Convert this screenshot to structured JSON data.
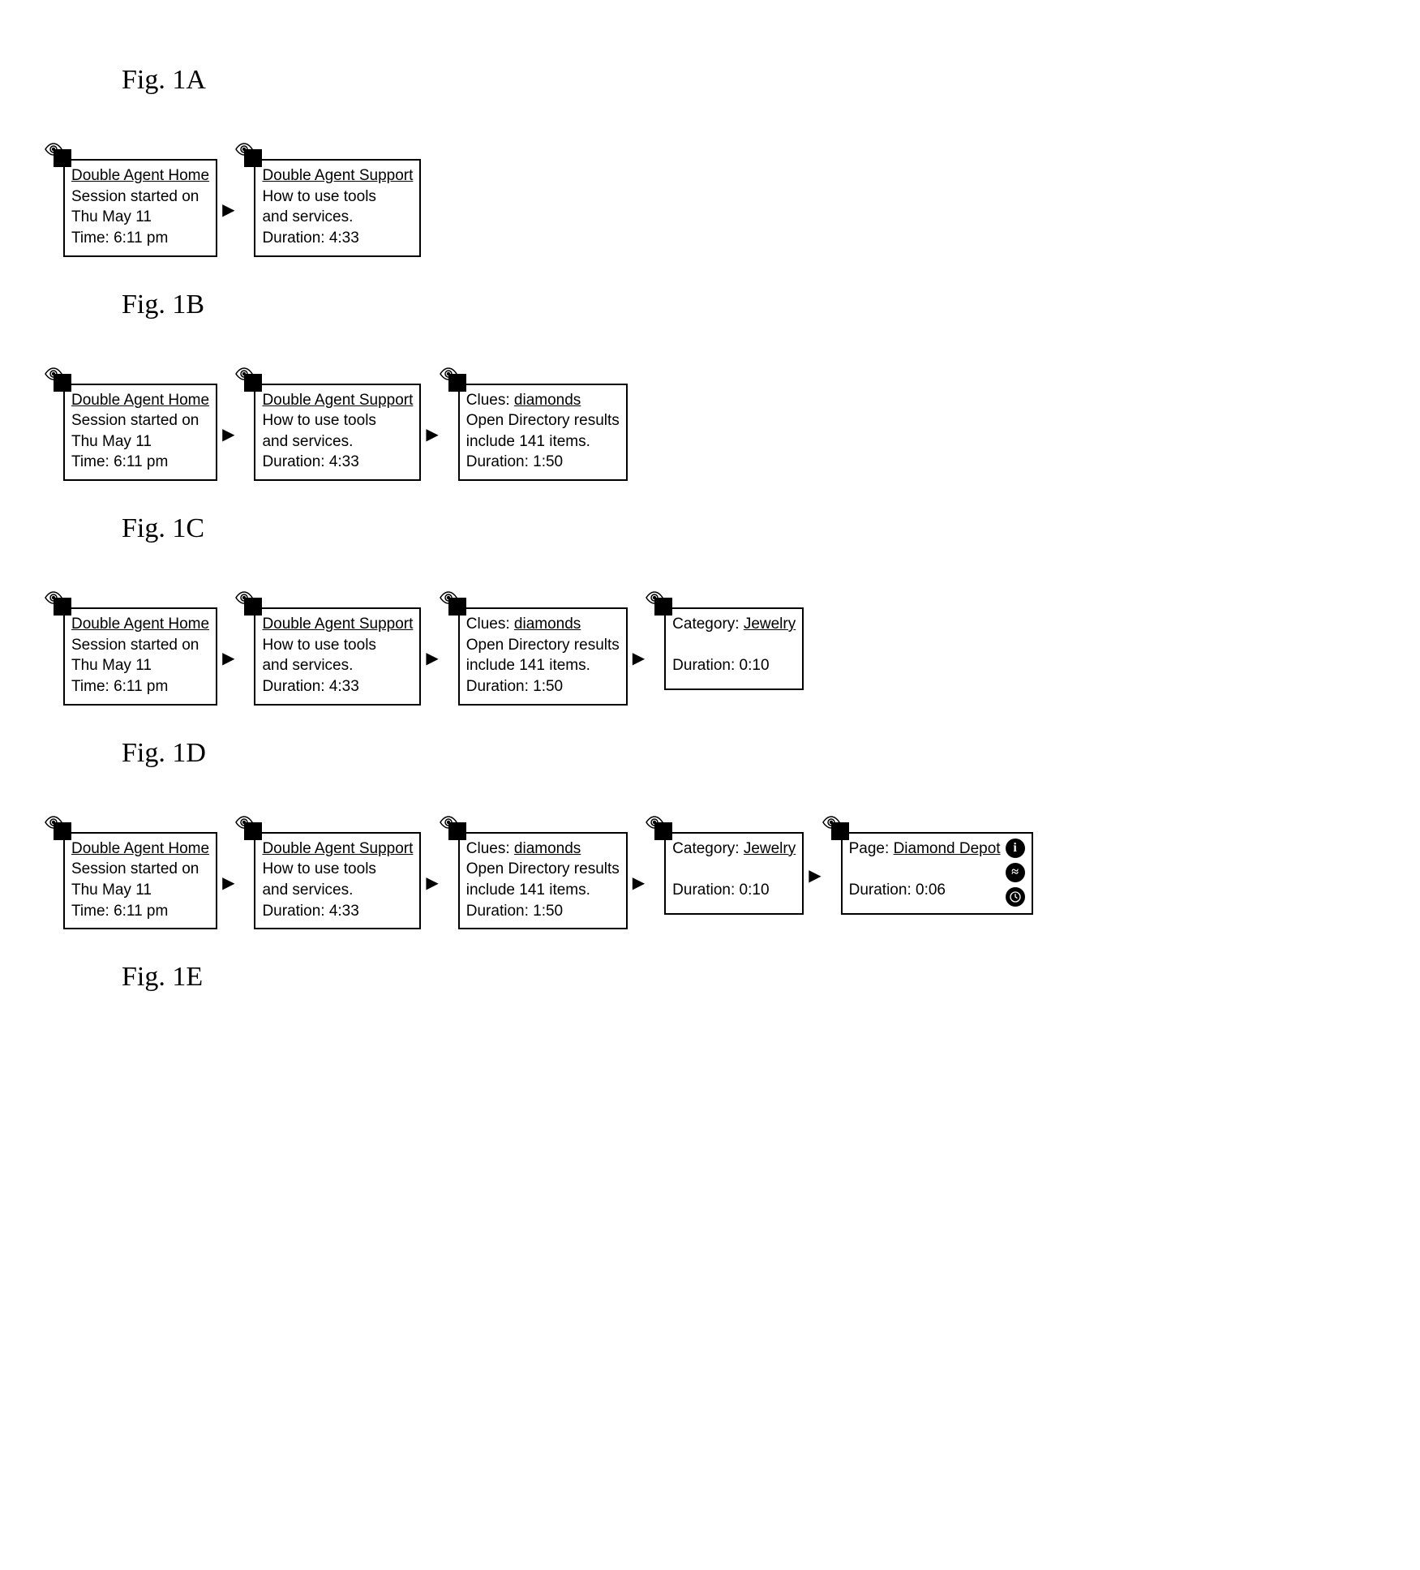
{
  "figures": [
    {
      "label": "Fig. 1A"
    },
    {
      "label": "Fig. 1B"
    },
    {
      "label": "Fig. 1C"
    },
    {
      "label": "Fig. 1D"
    },
    {
      "label": "Fig. 1E"
    }
  ],
  "nodes": {
    "home": {
      "title": "Double Agent Home",
      "line1": "Session started on",
      "line2": "Thu May 11",
      "line3": "Time: 6:11 pm"
    },
    "support": {
      "title": "Double Agent Support",
      "line1": "How to use tools",
      "line2": "and services.",
      "line3": "Duration: 4:33"
    },
    "clues": {
      "prefix": "Clues: ",
      "link": "diamonds",
      "line1": "Open Directory results",
      "line2": "include 141 items.",
      "line3": "Duration: 1:50"
    },
    "category": {
      "prefix": "Category: ",
      "link": "Jewelry",
      "line1": "",
      "line2": "Duration: 0:10"
    },
    "page": {
      "prefix": "Page: ",
      "link": "Diamond Depot",
      "line1": "",
      "line2": "Duration: 0:06"
    }
  },
  "icons": {
    "info": "i",
    "approx": "≈",
    "clock": "clock"
  }
}
